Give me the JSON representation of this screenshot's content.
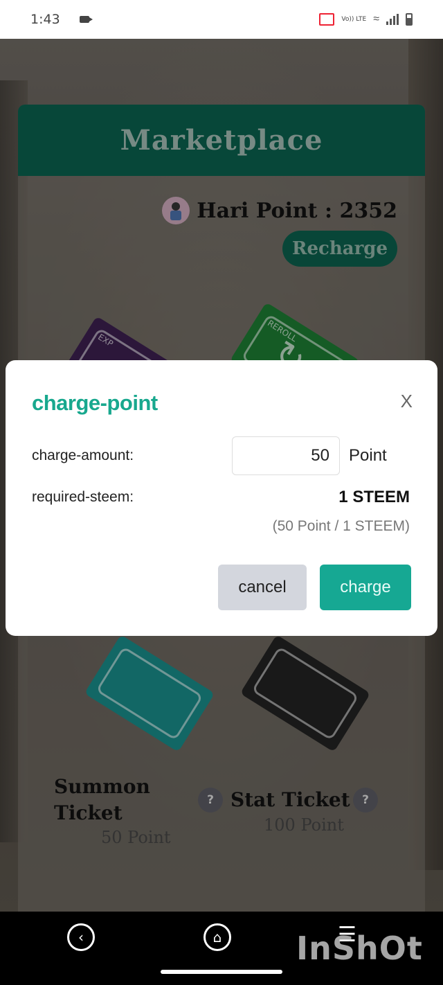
{
  "status_bar": {
    "time": "1:43",
    "icons": [
      "video-camera-icon",
      "cast-icon",
      "volte-icon",
      "wifi-icon",
      "signal-icon",
      "battery-icon"
    ],
    "volte_label": "Vo)) LTE"
  },
  "marketplace": {
    "title": "Marketplace",
    "points_label": "Hari Point : 2352",
    "recharge_label": "Recharge",
    "tickets": [
      {
        "tag": "EXP",
        "color": "#3b1f4e"
      },
      {
        "tag": "REROLL",
        "color": "#1d7a32"
      },
      {
        "name": "Summon\nTicket",
        "price": "50 Point",
        "color": "#198a87"
      },
      {
        "name": "Stat Ticket",
        "price": "100 Point",
        "color": "#222222"
      }
    ],
    "help_label": "?"
  },
  "modal": {
    "title": "charge-point",
    "close_label": "X",
    "charge_amount_label": "charge-amount:",
    "charge_amount_value": "50",
    "charge_amount_unit": "Point",
    "required_steem_label": "required-steem:",
    "required_steem_value": "1 STEEM",
    "rate_text": "(50 Point / 1 STEEM)",
    "cancel_label": "cancel",
    "charge_label": "charge",
    "accent_color": "#16a893"
  },
  "nav_bar": {
    "back_icon": "back-icon",
    "home_icon": "home-icon",
    "watermark": "InShOt"
  }
}
